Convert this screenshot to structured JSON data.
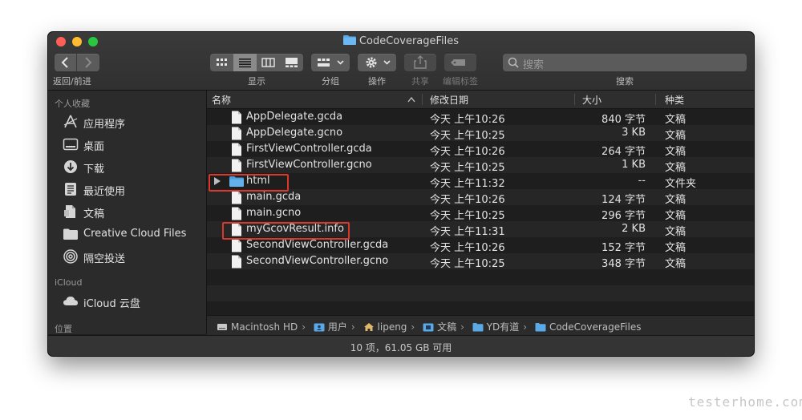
{
  "window": {
    "title": "CodeCoverageFiles"
  },
  "toolbar": {
    "back_forward_label": "返回/前进",
    "view_label": "显示",
    "group_label": "分组",
    "action_label": "操作",
    "share_label": "共享",
    "tags_label": "编辑标签",
    "search_label": "搜索",
    "search_placeholder": "搜索"
  },
  "sidebar": {
    "favorites_header": "个人收藏",
    "favorites": [
      {
        "label": "应用程序",
        "icon": "applications-icon"
      },
      {
        "label": "桌面",
        "icon": "desktop-icon"
      },
      {
        "label": "下载",
        "icon": "downloads-icon"
      },
      {
        "label": "最近使用",
        "icon": "recents-icon"
      },
      {
        "label": "文稿",
        "icon": "documents-icon"
      },
      {
        "label": "Creative Cloud Files",
        "icon": "folder-icon"
      },
      {
        "label": "隔空投送",
        "icon": "airdrop-icon"
      }
    ],
    "icloud_header": "iCloud",
    "icloud": [
      {
        "label": "iCloud 云盘",
        "icon": "cloud-icon"
      }
    ],
    "locations_header": "位置"
  },
  "columns": {
    "name": "名称",
    "date": "修改日期",
    "size": "大小",
    "kind": "种类"
  },
  "files": [
    {
      "name": "AppDelegate.gcda",
      "date": "今天 上午10:26",
      "size": "840 字节",
      "kind": "文稿",
      "type": "doc"
    },
    {
      "name": "AppDelegate.gcno",
      "date": "今天 上午10:25",
      "size": "3 KB",
      "kind": "文稿",
      "type": "doc"
    },
    {
      "name": "FirstViewController.gcda",
      "date": "今天 上午10:26",
      "size": "264 字节",
      "kind": "文稿",
      "type": "doc"
    },
    {
      "name": "FirstViewController.gcno",
      "date": "今天 上午10:25",
      "size": "1 KB",
      "kind": "文稿",
      "type": "doc"
    },
    {
      "name": "html",
      "date": "今天 上午11:32",
      "size": "--",
      "kind": "文件夹",
      "type": "folder"
    },
    {
      "name": "main.gcda",
      "date": "今天 上午10:26",
      "size": "124 字节",
      "kind": "文稿",
      "type": "doc"
    },
    {
      "name": "main.gcno",
      "date": "今天 上午10:25",
      "size": "296 字节",
      "kind": "文稿",
      "type": "doc"
    },
    {
      "name": "myGcovResult.info",
      "date": "今天 上午11:31",
      "size": "2 KB",
      "kind": "文稿",
      "type": "doc"
    },
    {
      "name": "SecondViewController.gcda",
      "date": "今天 上午10:26",
      "size": "152 字节",
      "kind": "文稿",
      "type": "doc"
    },
    {
      "name": "SecondViewController.gcno",
      "date": "今天 上午10:25",
      "size": "348 字节",
      "kind": "文稿",
      "type": "doc"
    }
  ],
  "highlighted": [
    "html",
    "myGcovResult.info"
  ],
  "pathbar": [
    "Macintosh HD",
    "用户",
    "lipeng",
    "文稿",
    "YD有道",
    "CodeCoverageFiles"
  ],
  "status": "10 项，61.05 GB 可用",
  "watermark": "testerhome.com",
  "colors": {
    "highlight_box": "#d9382a",
    "folder_blue": "#5aa9e6",
    "close": "#ff5f57",
    "minimize": "#febc2e",
    "maximize": "#28c840"
  }
}
